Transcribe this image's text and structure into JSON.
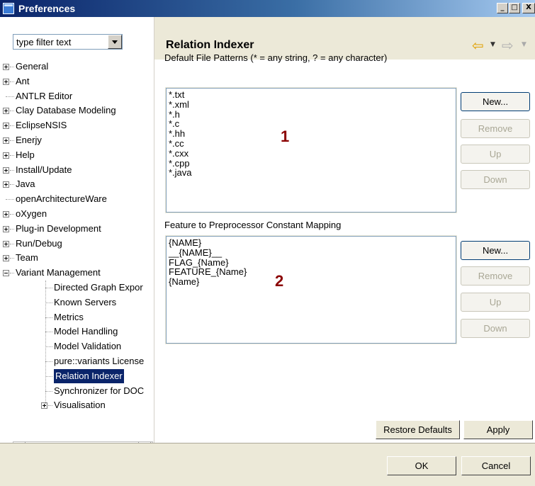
{
  "window": {
    "title": "Preferences",
    "minimize": "_",
    "maximize": "□",
    "close": "X"
  },
  "filter": {
    "placeholder": "type filter text",
    "value": "type filter text"
  },
  "tree": {
    "items": [
      {
        "label": "General",
        "expander": "plus"
      },
      {
        "label": "Ant",
        "expander": "plus"
      },
      {
        "label": "ANTLR Editor",
        "expander": "none"
      },
      {
        "label": "Clay Database Modeling",
        "expander": "plus"
      },
      {
        "label": "EclipseNSIS",
        "expander": "plus"
      },
      {
        "label": "Enerjy",
        "expander": "plus"
      },
      {
        "label": "Help",
        "expander": "plus"
      },
      {
        "label": "Install/Update",
        "expander": "plus"
      },
      {
        "label": "Java",
        "expander": "plus"
      },
      {
        "label": "openArchitectureWare",
        "expander": "none"
      },
      {
        "label": "oXygen",
        "expander": "plus"
      },
      {
        "label": "Plug-in Development",
        "expander": "plus"
      },
      {
        "label": "Run/Debug",
        "expander": "plus"
      },
      {
        "label": "Team",
        "expander": "plus"
      },
      {
        "label": "Variant Management",
        "expander": "minus"
      }
    ],
    "children": [
      {
        "label": "Directed Graph Expor"
      },
      {
        "label": "Known Servers"
      },
      {
        "label": "Metrics"
      },
      {
        "label": "Model Handling"
      },
      {
        "label": "Model Validation"
      },
      {
        "label": "pure::variants License"
      },
      {
        "label": "Relation Indexer",
        "selected": true
      },
      {
        "label": "Synchronizer for DOC"
      },
      {
        "label": "Visualisation",
        "expander": "plus"
      }
    ]
  },
  "page": {
    "title": "Relation Indexer",
    "nav_back_icon": "back-arrow-icon",
    "nav_forward_icon": "forward-arrow-icon"
  },
  "file_patterns": {
    "label": "Default File Patterns (* = any string, ? = any character)",
    "items": [
      "*.txt",
      "*.xml",
      "*.h",
      "*.c",
      "*.hh",
      "*.cc",
      "*.cxx",
      "*.cpp",
      "*.java"
    ],
    "marker": "1",
    "buttons": {
      "new": "New...",
      "remove": "Remove",
      "up": "Up",
      "down": "Down"
    }
  },
  "mapping": {
    "label": "Feature to Preprocessor Constant Mapping",
    "items": [
      "{NAME}",
      "__{NAME}__",
      "FLAG_{Name}",
      "FEATURE_{Name}",
      "{Name}"
    ],
    "marker": "2",
    "buttons": {
      "new": "New...",
      "remove": "Remove",
      "up": "Up",
      "down": "Down"
    }
  },
  "actions": {
    "restore_defaults": "Restore Defaults",
    "apply": "Apply"
  },
  "dialog": {
    "ok": "OK",
    "cancel": "Cancel"
  }
}
